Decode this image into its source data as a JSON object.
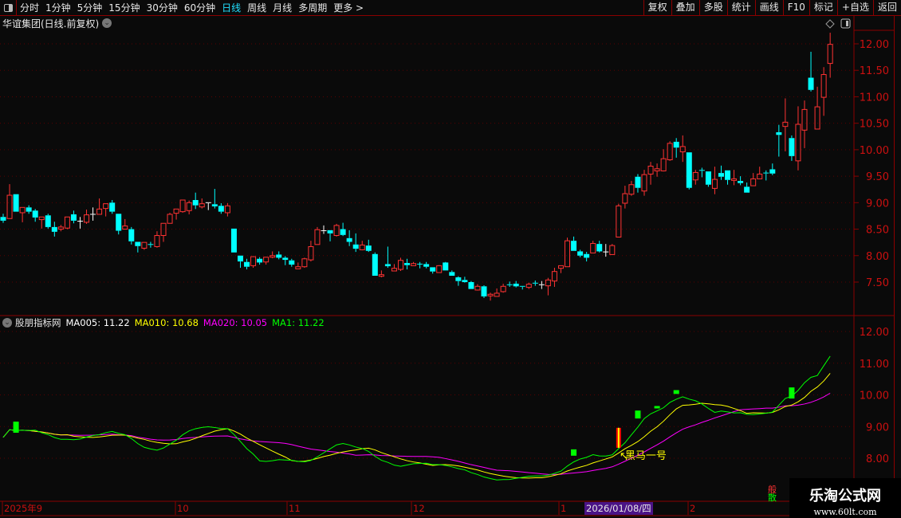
{
  "toolbar": {
    "periods": [
      "分时",
      "1分钟",
      "5分钟",
      "15分钟",
      "30分钟",
      "60分钟",
      "日线",
      "周线",
      "月线",
      "多周期",
      "更多 >"
    ],
    "active_period": "日线",
    "buttons": [
      "复权",
      "叠加",
      "多股",
      "统计",
      "画线",
      "F10",
      "标记",
      "+自选",
      "返回"
    ]
  },
  "main_panel": {
    "title": "华谊集团(日线.前复权)",
    "y_ticks": [
      "12.00",
      "11.50",
      "11.00",
      "10.50",
      "10.00",
      "9.50",
      "9.00",
      "8.50",
      "8.00",
      "7.50"
    ]
  },
  "indicator_panel": {
    "name": "股朋指标网",
    "legend": [
      {
        "label": "MA005: 11.22",
        "color": "#ffffff"
      },
      {
        "label": "MA010: 10.68",
        "color": "#ffff00"
      },
      {
        "label": "MA020: 10.05",
        "color": "#ff00ff"
      },
      {
        "label": "MA1: 11.22",
        "color": "#00ff00"
      }
    ],
    "y_ticks": [
      "12.00",
      "11.00",
      "10.00",
      "9.00",
      "8.00"
    ],
    "signal_label": "黑马一号",
    "side_marks": [
      "般",
      "散"
    ]
  },
  "date_axis": {
    "labels": [
      "2025年9",
      "10",
      "11",
      "12",
      "1",
      "2"
    ],
    "cursor_date": "2026/01/08/四"
  },
  "watermark": {
    "title": "乐淘公式网",
    "url": "www.60lt.com"
  },
  "colors": {
    "up": "#ff3333",
    "down": "#00ffff",
    "doji": "#ffffff",
    "axis": "#cc1010",
    "grid": "#5a0000",
    "ma5": "#00ff00",
    "ma10": "#ffff00",
    "ma20": "#ff00ff"
  },
  "chart_data": {
    "type": "candlestick",
    "series_format": [
      "open",
      "high",
      "low",
      "close"
    ],
    "ylim": [
      7.1,
      12.3
    ],
    "indicator_ylim": [
      7.6,
      12.5
    ],
    "candles": [
      [
        8.73,
        8.79,
        8.62,
        8.66
      ],
      [
        8.7,
        9.35,
        8.7,
        9.14
      ],
      [
        9.16,
        9.16,
        8.83,
        8.83
      ],
      [
        8.81,
        8.91,
        8.63,
        8.91
      ],
      [
        8.91,
        8.95,
        8.79,
        8.83
      ],
      [
        8.85,
        8.88,
        8.64,
        8.72
      ],
      [
        8.68,
        8.73,
        8.51,
        8.73
      ],
      [
        8.76,
        8.79,
        8.51,
        8.54
      ],
      [
        8.54,
        8.64,
        8.36,
        8.45
      ],
      [
        8.5,
        8.58,
        8.46,
        8.54
      ],
      [
        8.52,
        8.73,
        8.5,
        8.73
      ],
      [
        8.78,
        8.85,
        8.61,
        8.66
      ],
      [
        8.65,
        8.73,
        8.51,
        8.65
      ],
      [
        8.63,
        8.87,
        8.6,
        8.77
      ],
      [
        8.78,
        8.91,
        8.66,
        8.77
      ],
      [
        8.78,
        9.08,
        8.78,
        8.88
      ],
      [
        8.89,
        8.98,
        8.74,
        8.98
      ],
      [
        9.0,
        9.05,
        8.79,
        8.83
      ],
      [
        8.79,
        8.79,
        8.4,
        8.47
      ],
      [
        8.5,
        8.69,
        8.5,
        8.56
      ],
      [
        8.5,
        8.54,
        8.21,
        8.27
      ],
      [
        8.26,
        8.26,
        8.06,
        8.18
      ],
      [
        8.14,
        8.25,
        8.11,
        8.25
      ],
      [
        8.21,
        8.26,
        8.15,
        8.2
      ],
      [
        8.17,
        8.46,
        8.15,
        8.38
      ],
      [
        8.38,
        8.61,
        8.26,
        8.61
      ],
      [
        8.61,
        8.81,
        8.61,
        8.78
      ],
      [
        8.8,
        8.88,
        8.68,
        8.88
      ],
      [
        8.83,
        9.05,
        8.81,
        9.05
      ],
      [
        8.85,
        9.04,
        8.78,
        9.0
      ],
      [
        9.05,
        9.19,
        8.88,
        8.95
      ],
      [
        8.92,
        9.08,
        8.89,
        8.98
      ],
      [
        9.0,
        9.0,
        8.86,
        8.99
      ],
      [
        8.97,
        9.26,
        8.89,
        8.93
      ],
      [
        8.94,
        8.99,
        8.79,
        8.83
      ],
      [
        8.81,
        8.99,
        8.74,
        8.94
      ],
      [
        8.51,
        8.51,
        8.06,
        8.06
      ],
      [
        8.0,
        8.0,
        7.77,
        7.89
      ],
      [
        7.88,
        7.94,
        7.74,
        7.79
      ],
      [
        7.81,
        7.99,
        7.77,
        7.98
      ],
      [
        7.94,
        7.97,
        7.83,
        7.87
      ],
      [
        7.88,
        7.97,
        7.83,
        7.97
      ],
      [
        7.97,
        8.08,
        7.95,
        8.0
      ],
      [
        8.02,
        8.08,
        7.93,
        7.96
      ],
      [
        7.96,
        7.99,
        7.82,
        7.92
      ],
      [
        7.91,
        7.94,
        7.79,
        7.83
      ],
      [
        7.75,
        7.87,
        7.75,
        7.79
      ],
      [
        7.79,
        7.96,
        7.77,
        7.94
      ],
      [
        7.92,
        8.28,
        7.89,
        8.17
      ],
      [
        8.21,
        8.54,
        8.21,
        8.49
      ],
      [
        8.47,
        8.57,
        8.41,
        8.46
      ],
      [
        8.48,
        8.48,
        8.27,
        8.42
      ],
      [
        8.38,
        8.6,
        8.36,
        8.57
      ],
      [
        8.5,
        8.62,
        8.37,
        8.39
      ],
      [
        8.33,
        8.48,
        8.18,
        8.26
      ],
      [
        8.21,
        8.42,
        8.07,
        8.13
      ],
      [
        8.11,
        8.28,
        8.1,
        8.2
      ],
      [
        8.19,
        8.3,
        8.07,
        8.09
      ],
      [
        8.03,
        8.06,
        7.62,
        7.62
      ],
      [
        7.61,
        7.72,
        7.59,
        7.64
      ],
      [
        7.84,
        8.17,
        7.77,
        7.8
      ],
      [
        7.71,
        7.84,
        7.71,
        7.76
      ],
      [
        7.74,
        7.96,
        7.71,
        7.91
      ],
      [
        7.86,
        7.94,
        7.74,
        7.82
      ],
      [
        7.81,
        7.88,
        7.81,
        7.85
      ],
      [
        7.84,
        7.88,
        7.76,
        7.84
      ],
      [
        7.84,
        7.88,
        7.76,
        7.79
      ],
      [
        7.78,
        7.78,
        7.66,
        7.7
      ],
      [
        7.68,
        7.82,
        7.68,
        7.81
      ],
      [
        7.87,
        7.88,
        7.72,
        7.72
      ],
      [
        7.69,
        7.72,
        7.62,
        7.62
      ],
      [
        7.59,
        7.61,
        7.43,
        7.52
      ],
      [
        7.54,
        7.6,
        7.49,
        7.5
      ],
      [
        7.5,
        7.52,
        7.37,
        7.37
      ],
      [
        7.35,
        7.46,
        7.34,
        7.42
      ],
      [
        7.42,
        7.44,
        7.2,
        7.23
      ],
      [
        7.24,
        7.3,
        7.15,
        7.27
      ],
      [
        7.23,
        7.38,
        7.23,
        7.29
      ],
      [
        7.32,
        7.47,
        7.3,
        7.42
      ],
      [
        7.45,
        7.51,
        7.41,
        7.44
      ],
      [
        7.47,
        7.52,
        7.4,
        7.42
      ],
      [
        7.42,
        7.42,
        7.36,
        7.41
      ],
      [
        7.4,
        7.49,
        7.37,
        7.46
      ],
      [
        7.48,
        7.53,
        7.43,
        7.47
      ],
      [
        7.45,
        7.52,
        7.37,
        7.44
      ],
      [
        7.43,
        7.58,
        7.25,
        7.54
      ],
      [
        7.52,
        7.77,
        7.41,
        7.7
      ],
      [
        7.76,
        7.81,
        7.67,
        7.81
      ],
      [
        7.79,
        8.34,
        7.79,
        8.28
      ],
      [
        8.28,
        8.36,
        8.09,
        8.09
      ],
      [
        8.08,
        8.11,
        7.97,
        8.0
      ],
      [
        8.03,
        8.07,
        7.89,
        7.96
      ],
      [
        8.05,
        8.28,
        8.05,
        8.23
      ],
      [
        8.22,
        8.28,
        8.06,
        8.08
      ],
      [
        8.07,
        8.22,
        7.98,
        8.07
      ],
      [
        8.02,
        8.22,
        8.02,
        8.19
      ],
      [
        8.35,
        8.98,
        8.35,
        8.94
      ],
      [
        8.99,
        9.32,
        8.89,
        9.17
      ],
      [
        9.16,
        9.41,
        9.13,
        9.34
      ],
      [
        9.49,
        9.54,
        9.19,
        9.28
      ],
      [
        9.22,
        9.62,
        9.13,
        9.53
      ],
      [
        9.54,
        9.77,
        9.34,
        9.69
      ],
      [
        9.6,
        9.74,
        9.49,
        9.64
      ],
      [
        9.6,
        10.01,
        9.59,
        9.83
      ],
      [
        9.81,
        10.16,
        9.79,
        10.12
      ],
      [
        10.15,
        10.22,
        9.85,
        10.04
      ],
      [
        9.96,
        10.27,
        9.77,
        10.06
      ],
      [
        9.95,
        9.95,
        9.25,
        9.28
      ],
      [
        9.43,
        9.62,
        9.34,
        9.57
      ],
      [
        9.6,
        9.66,
        9.48,
        9.61
      ],
      [
        9.59,
        9.59,
        9.3,
        9.34
      ],
      [
        9.27,
        9.68,
        9.16,
        9.44
      ],
      [
        9.56,
        9.7,
        9.43,
        9.49
      ],
      [
        9.61,
        9.61,
        9.34,
        9.43
      ],
      [
        9.42,
        9.62,
        9.33,
        9.45
      ],
      [
        9.41,
        9.5,
        9.33,
        9.37
      ],
      [
        9.3,
        9.38,
        9.19,
        9.19
      ],
      [
        9.32,
        9.56,
        9.32,
        9.45
      ],
      [
        9.45,
        9.68,
        9.45,
        9.54
      ],
      [
        9.56,
        9.61,
        9.42,
        9.55
      ],
      [
        9.63,
        9.74,
        9.52,
        9.55
      ],
      [
        10.33,
        10.47,
        9.87,
        10.28
      ],
      [
        10.44,
        10.97,
        9.97,
        10.52
      ],
      [
        10.22,
        10.27,
        9.79,
        9.88
      ],
      [
        9.79,
        10.82,
        9.61,
        10.48
      ],
      [
        10.37,
        10.93,
        10.03,
        10.76
      ],
      [
        11.36,
        11.85,
        11.1,
        11.13
      ],
      [
        10.39,
        11.19,
        10.39,
        10.81
      ],
      [
        10.99,
        11.56,
        10.64,
        11.42
      ],
      [
        11.63,
        12.21,
        11.36,
        11.99
      ]
    ],
    "signals": [
      {
        "index": 2,
        "value": 8.98,
        "height": 0.35
      },
      {
        "index": 89,
        "value": 8.18,
        "height": 0.2
      },
      {
        "index": 99,
        "value": 9.38,
        "height": 0.25
      },
      {
        "index": 102,
        "value": 9.61,
        "height": 0.05
      },
      {
        "index": 105,
        "value": 10.09,
        "height": 0.12
      },
      {
        "index": 123,
        "value": 10.06,
        "height": 0.35
      }
    ],
    "buy_signal": {
      "index": 96,
      "top": 8.96,
      "bottom": 8.33
    }
  }
}
